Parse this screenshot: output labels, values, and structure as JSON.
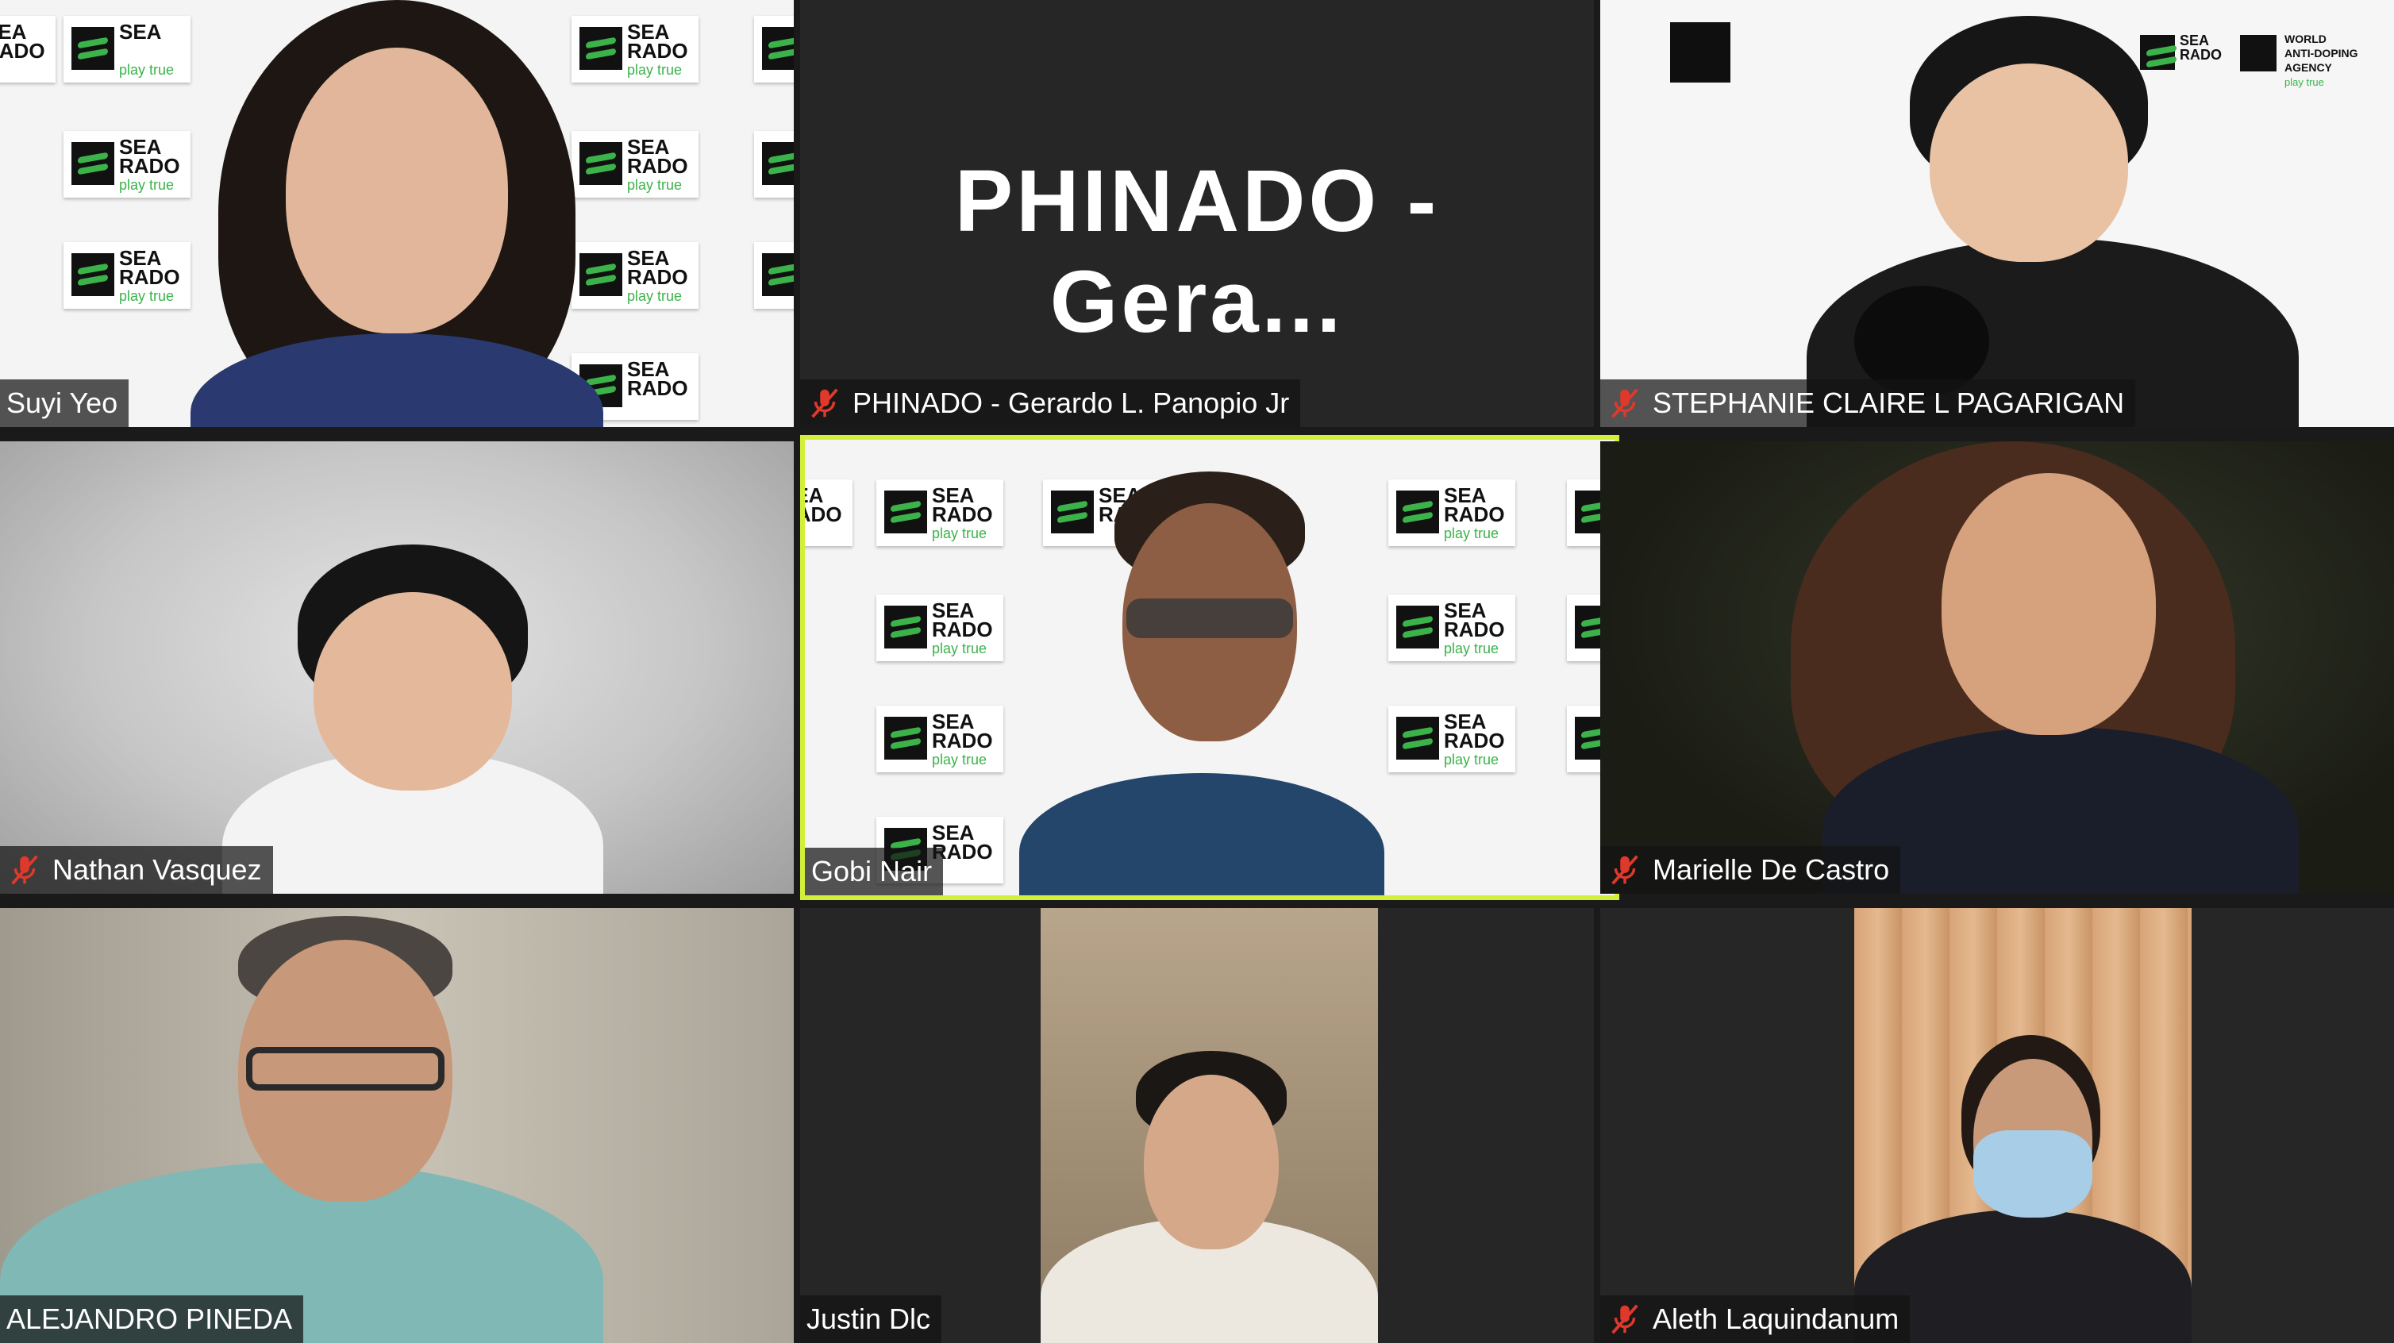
{
  "meeting": {
    "participants": [
      {
        "name": "Suyi Yeo",
        "muted": false,
        "active": false
      },
      {
        "name": "PHINADO - Gerardo L. Panopio Jr",
        "display_name": "PHINADO  -  Gera...",
        "muted": true,
        "active": false,
        "video_off": true
      },
      {
        "name": "STEPHANIE CLAIRE L PAGARIGAN",
        "muted": true,
        "active": false
      },
      {
        "name": "Nathan Vasquez",
        "muted": true,
        "active": false
      },
      {
        "name": "Gobi Nair",
        "muted": false,
        "active": true
      },
      {
        "name": "Marielle De Castro",
        "muted": true,
        "active": false
      },
      {
        "name": "ALEJANDRO PINEDA",
        "muted": false,
        "active": false
      },
      {
        "name": "Justin Dlc",
        "muted": false,
        "active": false
      },
      {
        "name": "Aleth Laquindanum",
        "muted": true,
        "active": false
      }
    ],
    "backdrop_logo": {
      "line1": "SEA",
      "line2": "RADO",
      "tagline": "play true"
    },
    "wada_logo": {
      "line1": "WORLD",
      "line2": "ANTI-DOPING",
      "line3": "AGENCY",
      "tagline": "play true"
    },
    "colors": {
      "active_speaker_border": "#d4ef3a",
      "muted_icon": "#e0392b",
      "brand_green": "#3bb34a"
    },
    "icons": [
      "muted-microphone-icon"
    ]
  }
}
